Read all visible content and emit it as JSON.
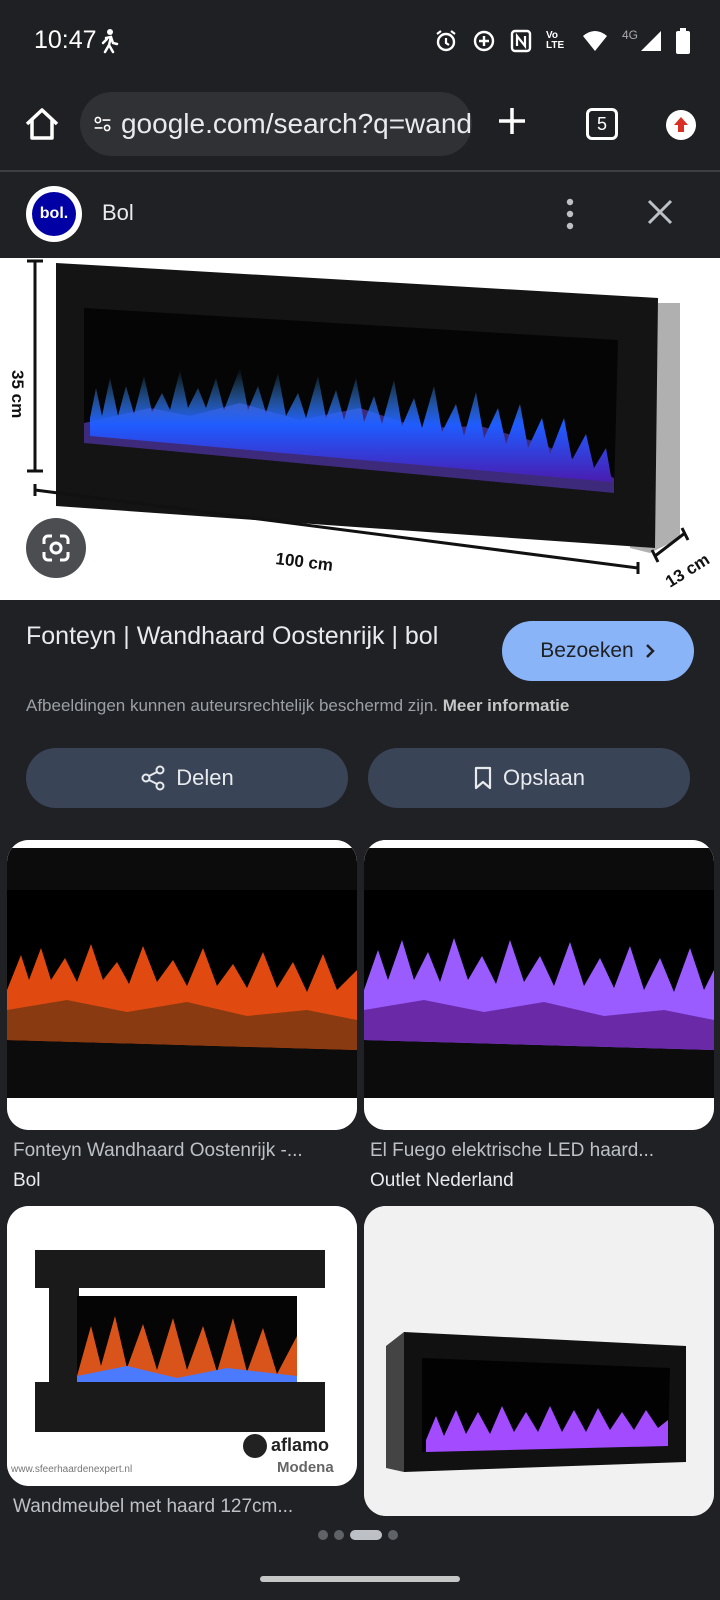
{
  "status_bar": {
    "time": "10:47",
    "icons": [
      "walk-icon",
      "alarm-icon",
      "data-saver-icon",
      "nfc-icon",
      "volte-icon",
      "wifi-icon",
      "4g-signal-icon",
      "battery-icon"
    ],
    "volte_label": "Vo LTE",
    "network_label": "4G"
  },
  "browser": {
    "url": "google.com/search?q=wand",
    "tab_count": "5"
  },
  "source": {
    "logo_text": "bol.",
    "name": "Bol"
  },
  "hero": {
    "dim_height": "35 cm",
    "dim_width": "100 cm",
    "dim_depth": "13 cm"
  },
  "result": {
    "title": "Fonteyn | Wandhaard Oostenrijk | bol",
    "visit_label": "Bezoeken",
    "disclaimer": "Afbeeldingen kunnen auteursrechtelijk beschermd zijn.",
    "more_info": "Meer informatie",
    "share_label": "Delen",
    "save_label": "Opslaan"
  },
  "related": [
    {
      "title": "Fonteyn Wandhaard Oostenrijk -...",
      "source": "Bol"
    },
    {
      "title": "El Fuego elektrische LED haard...",
      "source": "Outlet Nederland"
    },
    {
      "title": "Wandmeubel met haard 127cm...",
      "source": ""
    },
    {
      "title": "",
      "source": ""
    }
  ],
  "watermark": {
    "brand": "aflamo",
    "model": "Modena",
    "site": "www.sfeerhaardenexpert.nl"
  },
  "colors": {
    "background": "#202124",
    "accent": "#8ab4f8",
    "chip": "#394457",
    "bol_blue": "#0000a4"
  }
}
